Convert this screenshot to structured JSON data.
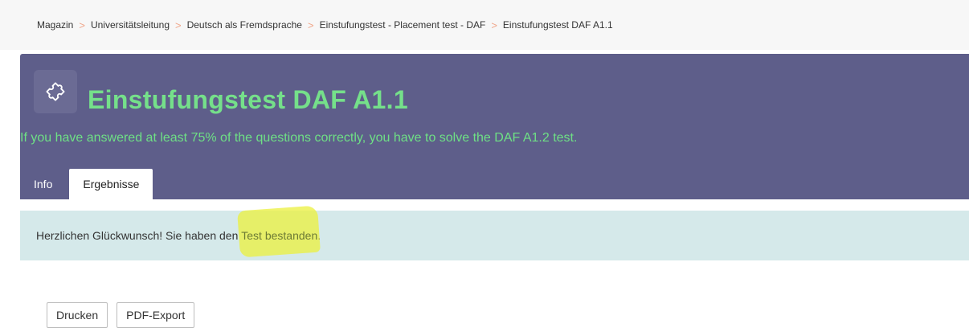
{
  "breadcrumb": {
    "items": [
      "Magazin",
      "Universitätsleitung",
      "Deutsch als Fremdsprache",
      "Einstufungstest - Placement test - DAF",
      "Einstufungstest DAF A1.1"
    ],
    "separator": ">"
  },
  "header": {
    "icon": "puzzle-icon",
    "title": "Einstufungstest DAF A1.1",
    "description": "If you have answered at least 75% of the questions correctly, you have to solve the DAF A1.2 test.",
    "background_color": "#5e5e8a",
    "accent_color": "#75e08a"
  },
  "tabs": [
    {
      "label": "Info",
      "active": false
    },
    {
      "label": "Ergebnisse",
      "active": true
    }
  ],
  "alert": {
    "text_before": "Herzlichen Glückwunsch! Sie haben den ",
    "highlight": "Test bestanden",
    "text_after": ".",
    "background_color": "#d5e9ea",
    "highlight_color": "#ebf03c"
  },
  "actions": {
    "print_label": "Drucken",
    "pdf_label": "PDF-Export"
  }
}
